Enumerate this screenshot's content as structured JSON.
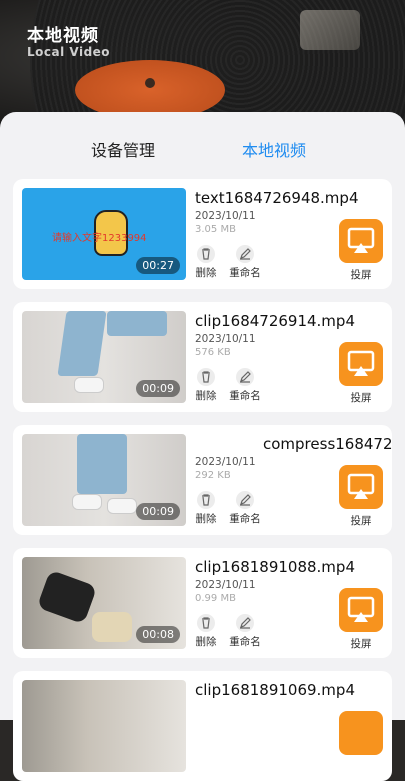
{
  "header": {
    "title": "本地视频",
    "subtitle": "Local Video"
  },
  "tabs": [
    {
      "label": "设备管理",
      "active": false
    },
    {
      "label": "本地视频",
      "active": true
    }
  ],
  "actions": {
    "delete": "删除",
    "rename": "重命名",
    "cast": "投屏"
  },
  "videos": [
    {
      "name": "text1684726948.mp4",
      "date": "2023/10/11",
      "size": "3.05 MB",
      "duration": "00:27",
      "overlay": "请输入文字1233994"
    },
    {
      "name": "clip1684726914.mp4",
      "date": "2023/10/11",
      "size": "576 KB",
      "duration": "00:09"
    },
    {
      "name": "compress168472",
      "date": "2023/10/11",
      "size": "292 KB",
      "duration": "00:09"
    },
    {
      "name": "clip1681891088.mp4",
      "date": "2023/10/11",
      "size": "0.99 MB",
      "duration": "00:08"
    },
    {
      "name": "clip1681891069.mp4"
    }
  ],
  "colors": {
    "accent": "#1f8cf0",
    "cast": "#f7931e"
  }
}
